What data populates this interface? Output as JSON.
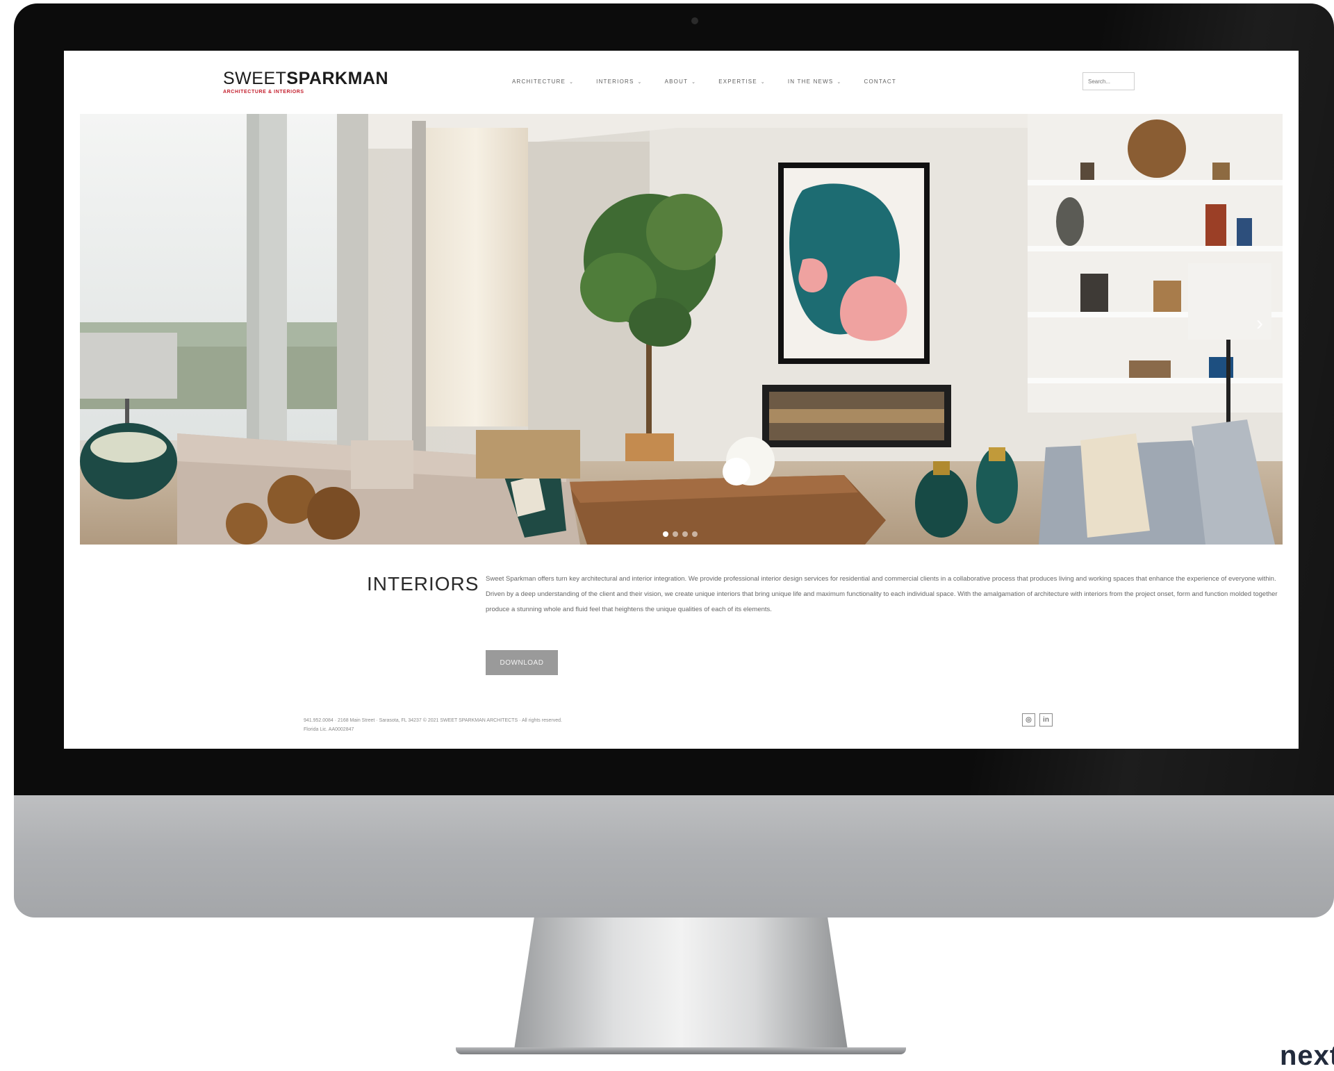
{
  "header": {
    "logo_primary": "SWEET",
    "logo_secondary": "SPARKMAN",
    "logo_tagline": "ARCHITECTURE & INTERIORS",
    "search_placeholder": "Search..."
  },
  "nav": [
    {
      "label": "ARCHITECTURE",
      "has_dropdown": true
    },
    {
      "label": "INTERIORS",
      "has_dropdown": true
    },
    {
      "label": "ABOUT",
      "has_dropdown": true
    },
    {
      "label": "EXPERTISE",
      "has_dropdown": true
    },
    {
      "label": "IN THE NEWS",
      "has_dropdown": true
    },
    {
      "label": "CONTACT",
      "has_dropdown": false
    }
  ],
  "slider": {
    "slide_count": 4,
    "active_slide": 1,
    "next_arrow": "›"
  },
  "content": {
    "title": "INTERIORS",
    "body": "Sweet Sparkman offers turn key architectural and interior integration. We provide professional interior design services for residential and commercial clients in a collaborative process that produces living and working spaces that enhance the experience of everyone within. Driven by a deep understanding of the client and their vision, we create unique interiors that bring unique life and maximum functionality to each individual space. With the amalgamation of architecture with interiors from the project onset, form and function molded together produce a stunning whole and fluid feel that heightens the unique qualities of each of its elements.",
    "download_label": "DOWNLOAD"
  },
  "footer": {
    "line1": "941.952.0084 · 2168 Main Street · Sarasota, FL 34237 © 2021 SWEET SPARKMAN ARCHITECTS · All rights reserved.",
    "line2": "Florida Lic. AA0002847",
    "social": [
      {
        "name": "instagram",
        "glyph": "◎"
      },
      {
        "name": "linkedin",
        "glyph": "in"
      }
    ]
  },
  "brand_mark": "next",
  "colors": {
    "brand_red": "#c4202e",
    "bezel": "#0c0c0c",
    "button_gray": "#9a9a9a",
    "text_dark": "#2a2a2a"
  }
}
